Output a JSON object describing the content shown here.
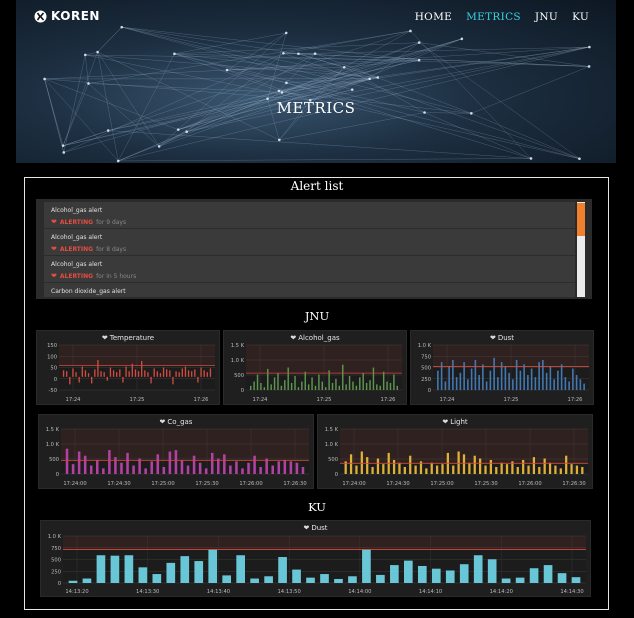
{
  "brand": {
    "name": "KOREN"
  },
  "nav": {
    "items": [
      {
        "label": "HOME",
        "active": false
      },
      {
        "label": "METRICS",
        "active": true
      },
      {
        "label": "JNU",
        "active": false
      },
      {
        "label": "KU",
        "active": false
      }
    ]
  },
  "hero": {
    "title": "METRICS"
  },
  "alert_list": {
    "title": "Alert list",
    "items": [
      {
        "name": "Alcohol_gas alert",
        "state": "ALERTING",
        "duration": "for 9 days"
      },
      {
        "name": "Alcohol_gas alert",
        "state": "ALERTING",
        "duration": "for 8 days"
      },
      {
        "name": "Alcohol_gas alert",
        "state": "ALERTING",
        "duration": "for in 5 hours"
      },
      {
        "name": "Carbon dioxide_gas alert",
        "state": "",
        "duration": ""
      }
    ]
  },
  "sections": {
    "jnu": "JNU",
    "ku": "KU"
  },
  "colors": {
    "accent": "#36d1e0",
    "alert": "#e24d42",
    "threshold": "#d44a3a"
  },
  "chart_data": [
    {
      "type": "bar",
      "title": "Temperature",
      "color": "#e24d42",
      "yticks": [
        "150",
        "100",
        "50",
        "0",
        "-50"
      ],
      "ylim": [
        -70,
        170
      ],
      "xticks": [
        "17:24",
        "17:25",
        "17:26"
      ],
      "threshold": 60,
      "values": [
        35,
        30,
        -40,
        45,
        25,
        -30,
        55,
        35,
        20,
        -35,
        40,
        90,
        30,
        25,
        -20,
        50,
        35,
        25,
        40,
        -30,
        55,
        30,
        70,
        40,
        30,
        85,
        35,
        25,
        -35,
        45,
        30,
        20,
        50,
        40,
        35,
        -40,
        30,
        25,
        45,
        55,
        35,
        30,
        40,
        -30,
        50,
        35,
        25,
        45
      ]
    },
    {
      "type": "bar",
      "title": "Alcohol_gas",
      "color": "#629e51",
      "yticks": [
        "1.5 K",
        "1.0 K",
        "500",
        "0"
      ],
      "ylim": [
        0,
        1600
      ],
      "xticks": [
        "17:24",
        "17:25",
        "17:26"
      ],
      "threshold": 600,
      "values": [
        150,
        300,
        550,
        250,
        100,
        750,
        200,
        450,
        600,
        150,
        350,
        800,
        250,
        500,
        100,
        300,
        650,
        200,
        450,
        150,
        550,
        300,
        100,
        700,
        250,
        400,
        150,
        900,
        200,
        500,
        300,
        150,
        450,
        600,
        250,
        350,
        800,
        200,
        150,
        650,
        300,
        250,
        550,
        150
      ]
    },
    {
      "type": "bar",
      "title": "Dust",
      "color": "#447ebc",
      "yticks": [
        "1.0 K",
        "750",
        "500",
        "250",
        "0"
      ],
      "ylim": [
        0,
        1050
      ],
      "xticks": [
        "17:24",
        "17:25",
        "17:26"
      ],
      "threshold": 550,
      "values": [
        450,
        650,
        200,
        550,
        700,
        300,
        400,
        650,
        250,
        500,
        700,
        350,
        600,
        200,
        450,
        750,
        300,
        650,
        550,
        400,
        250,
        700,
        450,
        600,
        350,
        500,
        300,
        650,
        700,
        400,
        550,
        250,
        450,
        600,
        300,
        200,
        500,
        350,
        250,
        150
      ]
    },
    {
      "type": "bar",
      "title": "Co_gas",
      "color": "#ba43a9",
      "yticks": [
        "1.5 K",
        "1.0 K",
        "500",
        "0"
      ],
      "ylim": [
        0,
        1600
      ],
      "xticks": [
        "17:24:00",
        "17:24:30",
        "17:25:00",
        "17:25:30",
        "17:26:00",
        "17:26:30"
      ],
      "threshold": 480,
      "values": [
        900,
        350,
        800,
        650,
        300,
        500,
        200,
        850,
        600,
        400,
        750,
        300,
        550,
        200,
        450,
        700,
        250,
        800,
        850,
        500,
        300,
        650,
        400,
        200,
        750,
        550,
        700,
        300,
        450,
        200,
        400,
        650,
        250,
        550,
        300,
        450,
        500,
        450,
        400,
        250
      ]
    },
    {
      "type": "bar",
      "title": "Light",
      "color": "#eab839",
      "yticks": [
        "1.5 K",
        "1.0 K",
        "500",
        "0"
      ],
      "ylim": [
        0,
        1600
      ],
      "xticks": [
        "17:24:00",
        "17:24:30",
        "17:25:00",
        "17:25:30",
        "17:26:00",
        "17:26:30"
      ],
      "threshold": 380,
      "values": [
        450,
        700,
        300,
        800,
        600,
        250,
        550,
        350,
        750,
        500,
        400,
        250,
        650,
        300,
        450,
        200,
        400,
        300,
        350,
        750,
        300,
        800,
        700,
        400,
        650,
        550,
        300,
        500,
        250,
        400,
        350,
        450,
        250,
        500,
        300,
        600,
        250,
        550,
        400,
        300,
        200,
        650,
        350,
        300,
        250
      ]
    },
    {
      "type": "bar",
      "title": "Dust",
      "color": "#6ed0e0",
      "yticks": [
        "1.0 K",
        "750",
        "500",
        "250",
        "0"
      ],
      "ylim": [
        0,
        1050
      ],
      "xticks": [
        "14:13:20",
        "14:13:30",
        "14:13:40",
        "14:13:50",
        "14:14:00",
        "14:14:10",
        "14:14:20",
        "14:14:30"
      ],
      "threshold": 750,
      "values": [
        50,
        100,
        620,
        610,
        620,
        350,
        200,
        450,
        600,
        490,
        750,
        170,
        620,
        100,
        150,
        580,
        300,
        120,
        200,
        90,
        150,
        750,
        180,
        400,
        500,
        380,
        320,
        280,
        420,
        620,
        530,
        100,
        120,
        330,
        400,
        220,
        130
      ]
    }
  ]
}
